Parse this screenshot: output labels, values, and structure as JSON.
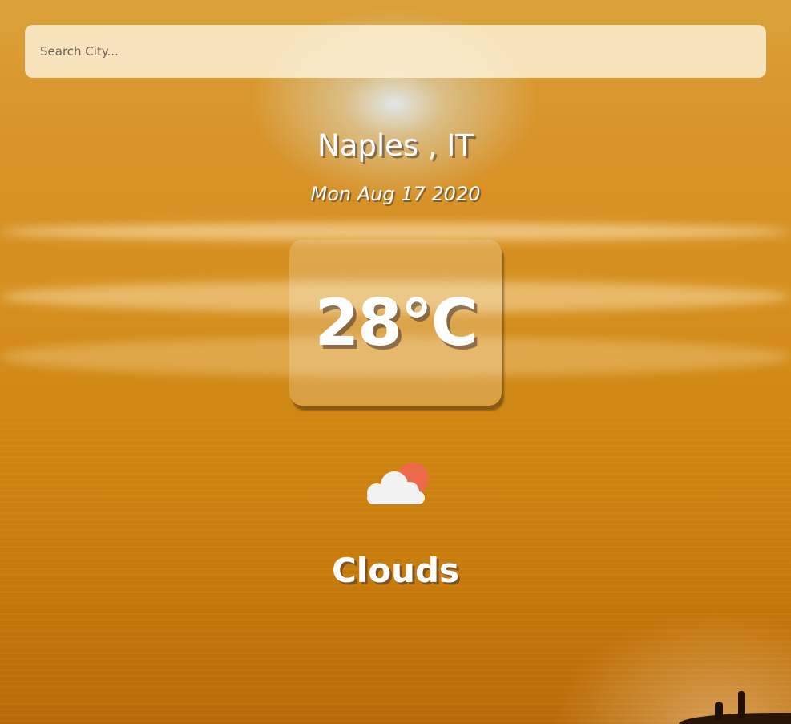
{
  "search": {
    "placeholder": "Search City...",
    "value": ""
  },
  "location": {
    "label": "Naples , IT"
  },
  "date": {
    "label": "Mon Aug 17 2020"
  },
  "temperature": {
    "label": "28°C"
  },
  "weather": {
    "icon": "clouds-sun-icon",
    "condition": "Clouds"
  },
  "colors": {
    "background_top": "#dba23a",
    "background_bottom": "#b76a08",
    "sun_accent": "#ec6a4a",
    "cloud": "#f2f2f2",
    "text": "#ffffff"
  }
}
